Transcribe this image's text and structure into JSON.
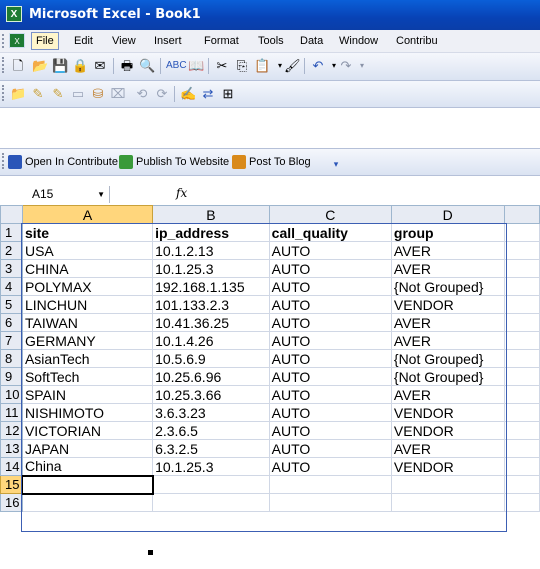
{
  "window": {
    "title": "Microsoft Excel - Book1"
  },
  "menu": [
    "File",
    "Edit",
    "View",
    "Insert",
    "Format",
    "Tools",
    "Data",
    "Window",
    "Contribu"
  ],
  "contribute_toolbar": {
    "open": "Open In Contribute",
    "publish": "Publish To Website",
    "post": "Post To Blog"
  },
  "formula_bar": {
    "name_box": "A15",
    "fx": "fx"
  },
  "columns": [
    "A",
    "B",
    "C",
    "D"
  ],
  "rows": [
    {
      "num": "1",
      "cells": [
        "site",
        "ip_address",
        "call_quality",
        "group"
      ]
    },
    {
      "num": "2",
      "cells": [
        "USA",
        "10.1.2.13",
        "AUTO",
        "AVER"
      ]
    },
    {
      "num": "3",
      "cells": [
        "CHINA",
        "10.1.25.3",
        "AUTO",
        "AVER"
      ]
    },
    {
      "num": "4",
      "cells": [
        "POLYMAX",
        "192.168.1.135",
        "AUTO",
        "{Not Grouped}"
      ]
    },
    {
      "num": "5",
      "cells": [
        "LINCHUN",
        "101.133.2.3",
        "AUTO",
        "VENDOR"
      ]
    },
    {
      "num": "6",
      "cells": [
        "TAIWAN",
        "10.41.36.25",
        "AUTO",
        "AVER"
      ]
    },
    {
      "num": "7",
      "cells": [
        "GERMANY",
        "10.1.4.26",
        "AUTO",
        "AVER"
      ]
    },
    {
      "num": "8",
      "cells": [
        "AsianTech",
        "10.5.6.9",
        "AUTO",
        "{Not Grouped}"
      ]
    },
    {
      "num": "9",
      "cells": [
        "SoftTech",
        "10.25.6.96",
        "AUTO",
        "{Not Grouped}"
      ]
    },
    {
      "num": "10",
      "cells": [
        "SPAIN",
        "10.25.3.66",
        "AUTO",
        "AVER"
      ]
    },
    {
      "num": "11",
      "cells": [
        "NISHIMOTO",
        "3.6.3.23",
        "AUTO",
        "VENDOR"
      ]
    },
    {
      "num": "12",
      "cells": [
        "VICTORIAN",
        "2.3.6.5",
        "AUTO",
        "VENDOR"
      ]
    },
    {
      "num": "13",
      "cells": [
        "JAPAN",
        "6.3.2.5",
        "AUTO",
        "AVER"
      ]
    },
    {
      "num": "14",
      "cells": [
        "China",
        "10.1.25.3",
        "AUTO",
        "VENDOR"
      ]
    },
    {
      "num": "15",
      "cells": [
        "",
        "",
        "",
        ""
      ]
    },
    {
      "num": "16",
      "cells": [
        "",
        "",
        "",
        ""
      ]
    }
  ]
}
